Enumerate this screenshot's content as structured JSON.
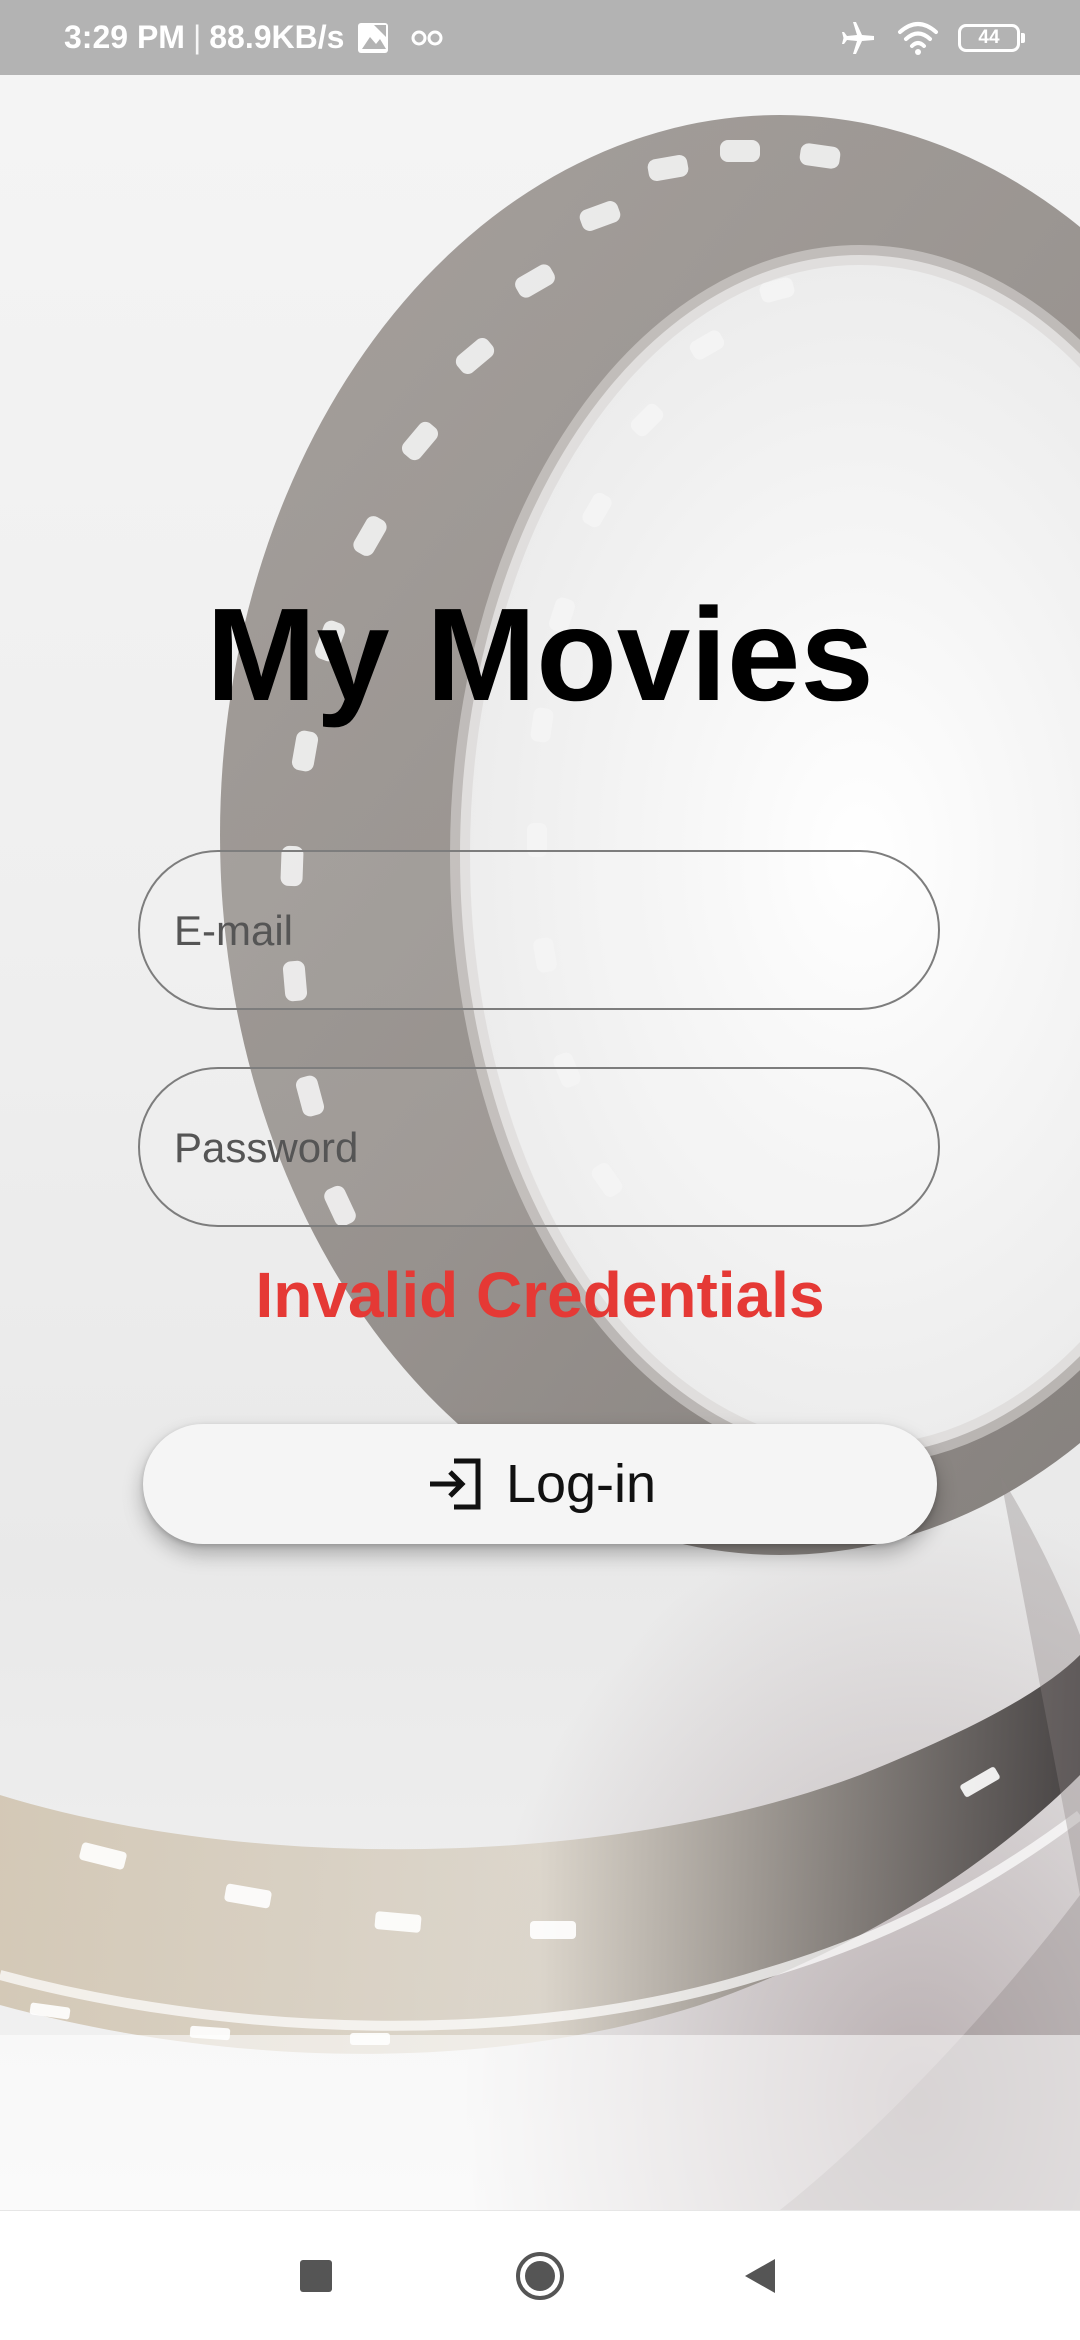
{
  "status_bar": {
    "time": "3:29 PM",
    "separator": "|",
    "network_speed": "88.9KB/s",
    "battery_level": "44",
    "icons": [
      "image-icon",
      "infinity-icon",
      "airplane-icon",
      "wifi-icon",
      "battery-icon"
    ]
  },
  "app": {
    "title": "My Movies"
  },
  "login_form": {
    "email_placeholder": "E-mail",
    "email_value": "",
    "password_placeholder": "Password",
    "password_value": "",
    "error_message": "Invalid Credentials",
    "login_label": "Log-in",
    "login_icon": "login-icon"
  },
  "nav_bar": {
    "buttons": [
      "recents-icon",
      "home-icon",
      "back-icon"
    ]
  },
  "colors": {
    "status_bar_bg": "#b3b3b3",
    "error_text": "#e53935",
    "button_bg": "#f5f5f5",
    "title_text": "#000000"
  }
}
